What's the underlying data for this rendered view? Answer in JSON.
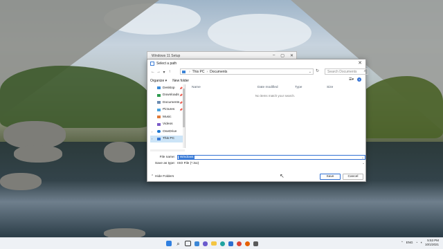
{
  "setup_window": {
    "title": "Windows 11 Setup"
  },
  "dialog": {
    "title": "Select a path",
    "nav": {
      "breadcrumb": [
        "This PC",
        "Documents"
      ],
      "search_placeholder": "Search Documents"
    },
    "toolbar": {
      "organize_label": "Organize ▾",
      "new_folder_label": "New folder"
    },
    "sidebar": {
      "items": [
        {
          "label": "Desktop",
          "icon": "desktop-icon",
          "pinned": true
        },
        {
          "label": "Downloads",
          "icon": "downloads-icon",
          "pinned": true
        },
        {
          "label": "Documents",
          "icon": "documents-icon",
          "pinned": true
        },
        {
          "label": "Pictures",
          "icon": "pictures-icon",
          "pinned": true
        },
        {
          "label": "Music",
          "icon": "music-icon",
          "pinned": false
        },
        {
          "label": "Videos",
          "icon": "videos-icon",
          "pinned": false
        },
        {
          "label": "OneDrive",
          "icon": "onedrive-icon",
          "pinned": false
        },
        {
          "label": "This PC",
          "icon": "this-pc-icon",
          "pinned": false,
          "selected": true
        }
      ]
    },
    "columns": [
      "Name",
      "Date modified",
      "Type",
      "Size"
    ],
    "empty_message": "No items match your search.",
    "file_name_label": "File name:",
    "file_name_value": "Windows",
    "save_as_type_label": "Save as type:",
    "save_as_type_value": "ISO File (*.iso)",
    "hide_folders_label": "Hide Folders",
    "save_label": "Save",
    "cancel_label": "Cancel"
  },
  "taskbar": {
    "clock_time": "5:53 PM",
    "clock_date": "10/1/2021",
    "lang": "ENG"
  },
  "colors": {
    "accent": "#2f6fd3",
    "selection": "#cce4f7"
  }
}
